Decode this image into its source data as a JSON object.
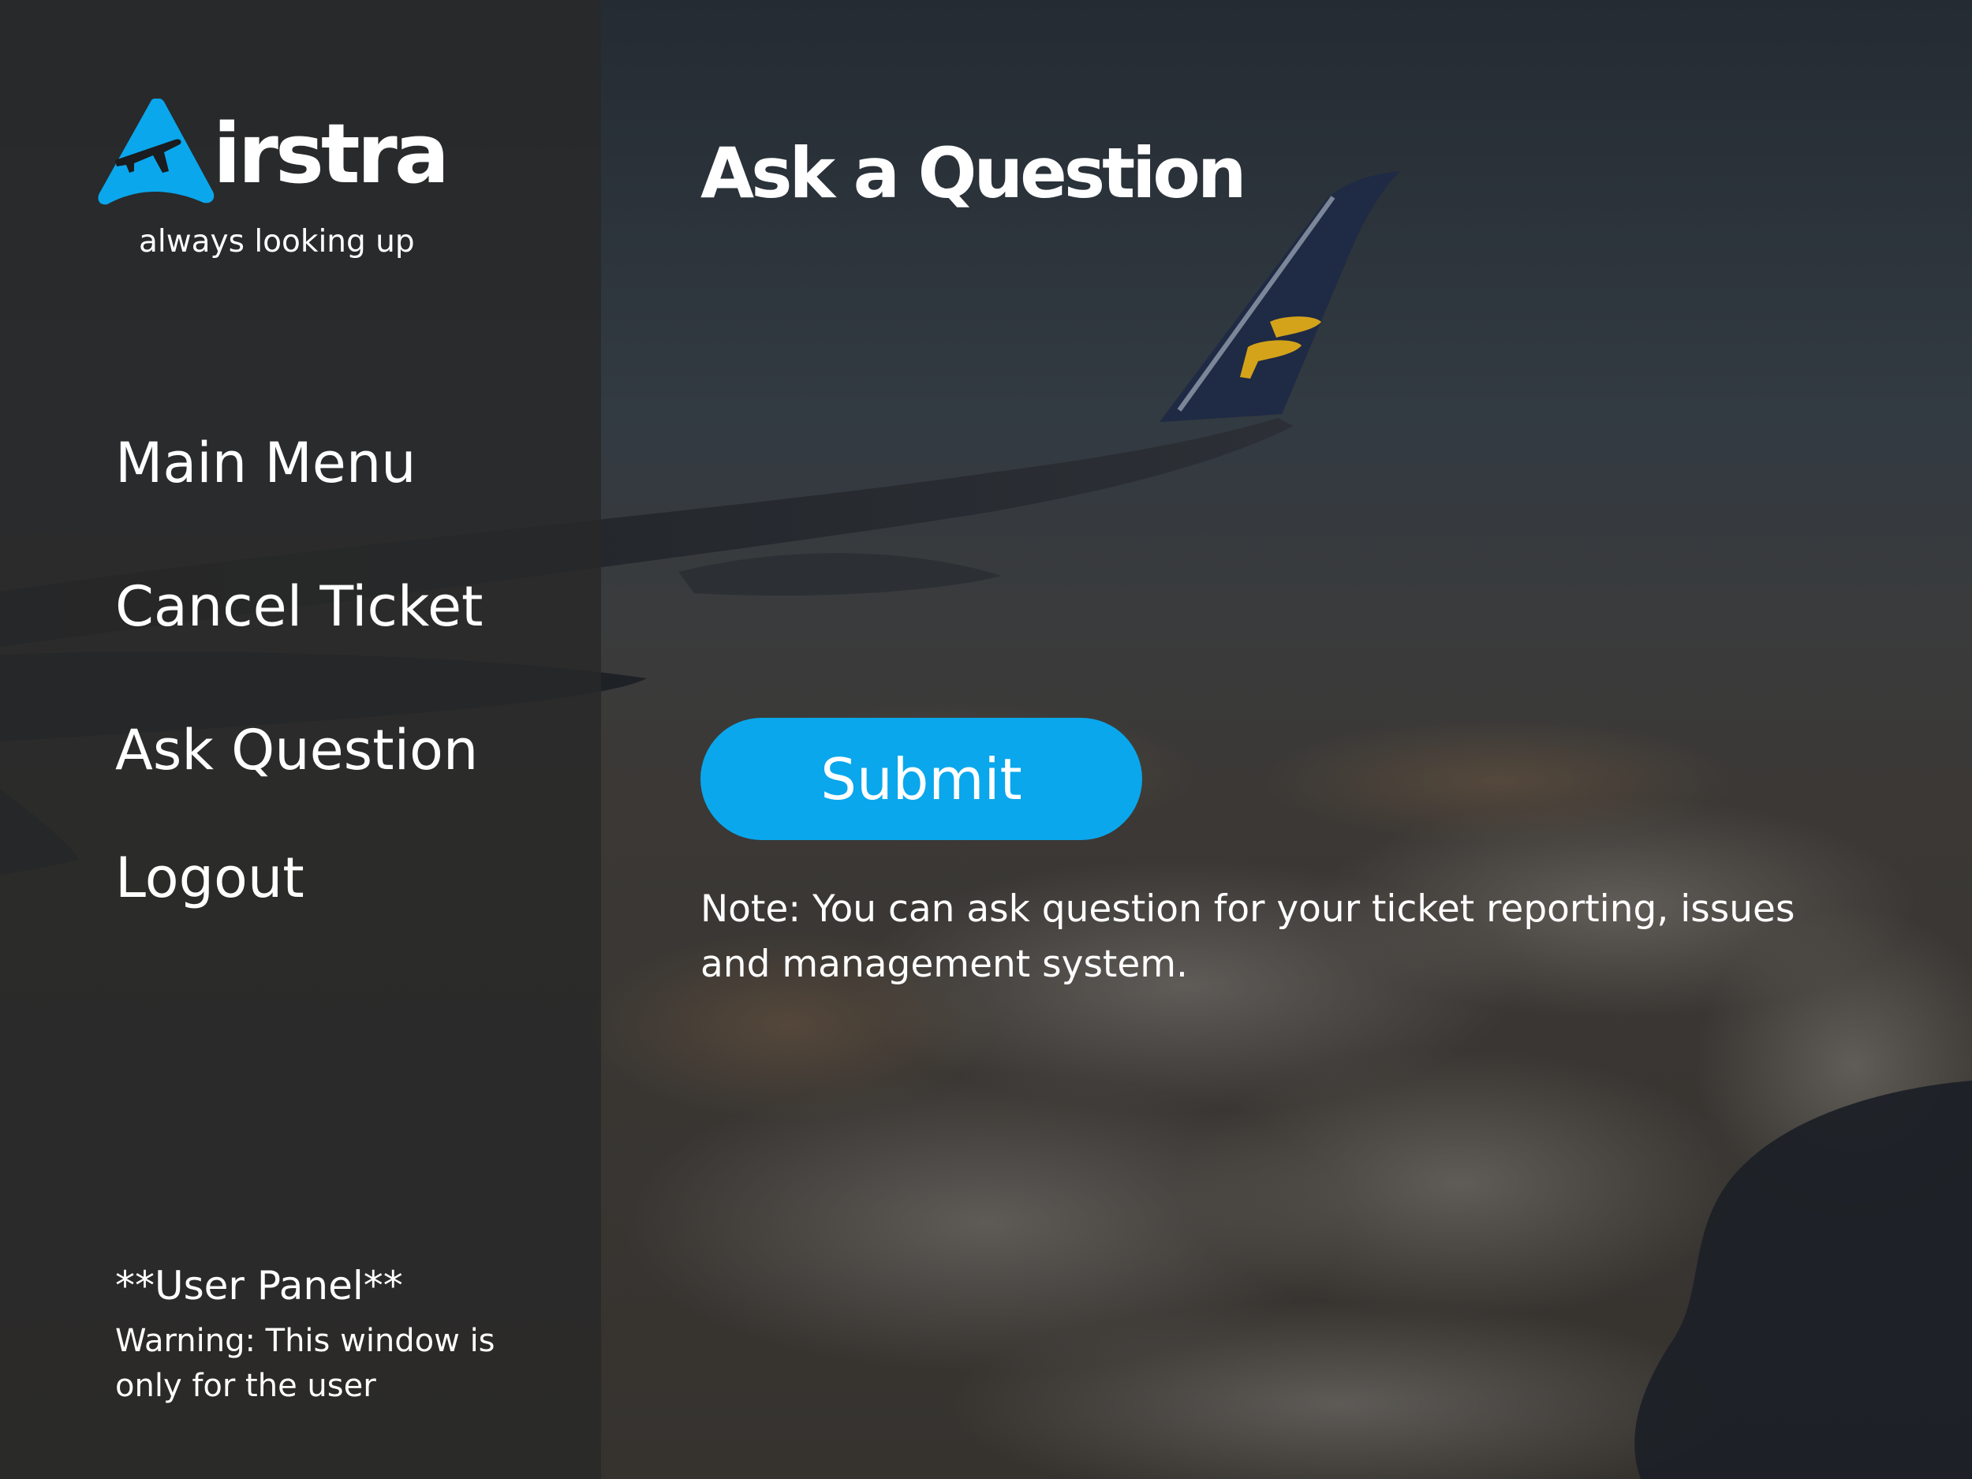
{
  "brand": {
    "logo_initial": "A",
    "logo_word": "irstra",
    "tagline": "always looking up",
    "accent_color": "#0aa7ec"
  },
  "sidebar": {
    "items": [
      {
        "label": "Main Menu"
      },
      {
        "label": "Cancel Ticket"
      },
      {
        "label": "Ask Question"
      },
      {
        "label": "Logout"
      }
    ],
    "panel_title": "**User Panel**",
    "panel_warning": "Warning: This window is only for the user"
  },
  "main": {
    "title": "Ask a Question",
    "submit_label": "Submit",
    "note": "Note: You can ask question for your ticket reporting, issues and management system."
  },
  "icons": {
    "logo": "airplane-triangle-icon"
  }
}
